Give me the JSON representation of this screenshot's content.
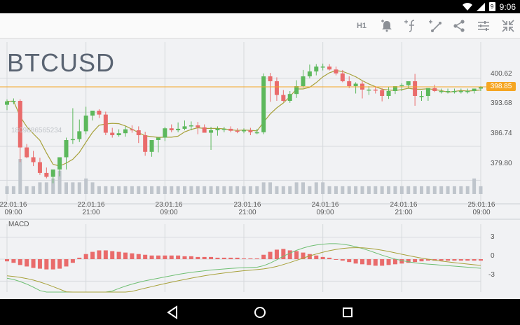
{
  "status": {
    "time": "9:06",
    "battery_level": "9"
  },
  "toolbar": {
    "interval": "H1"
  },
  "chart": {
    "symbol": "BTCUSD",
    "ghost_text": "1809886565234",
    "current_price": "398.85",
    "price_labels": [
      "400.62",
      "393.68",
      "386.74",
      "379.80"
    ],
    "time_labels": [
      {
        "date": "22.01.16",
        "time": "09:00"
      },
      {
        "date": "22.01.16",
        "time": "21:00"
      },
      {
        "date": "23.01.16",
        "time": "09:00"
      },
      {
        "date": "23.01.16",
        "time": "21:00"
      },
      {
        "date": "24.01.16",
        "time": "09:00"
      },
      {
        "date": "24.01.16",
        "time": "21:00"
      },
      {
        "date": "25.01.16",
        "time": "09:00"
      }
    ],
    "macd_title": "MACD",
    "macd_labels": [
      "3",
      "0",
      "-3"
    ],
    "colors": {
      "up": "#5cb85c",
      "down": "#e96b6b",
      "price_line": "#f5a623",
      "volume": "#bfc5cc"
    }
  },
  "chart_data": {
    "type": "candlestick",
    "x": [
      "22.01.16 09:00",
      "22.01.16 10:00",
      "22.01.16 11:00",
      "22.01.16 12:00",
      "22.01.16 13:00",
      "22.01.16 14:00",
      "22.01.16 15:00",
      "22.01.16 16:00",
      "22.01.16 17:00",
      "22.01.16 18:00",
      "22.01.16 19:00",
      "22.01.16 20:00",
      "22.01.16 21:00",
      "22.01.16 22:00",
      "22.01.16 23:00",
      "23.01.16 00:00",
      "23.01.16 01:00",
      "23.01.16 02:00",
      "23.01.16 03:00",
      "23.01.16 04:00",
      "23.01.16 05:00",
      "23.01.16 06:00",
      "23.01.16 07:00",
      "23.01.16 08:00",
      "23.01.16 09:00",
      "23.01.16 10:00",
      "23.01.16 11:00",
      "23.01.16 12:00",
      "23.01.16 13:00",
      "23.01.16 14:00",
      "23.01.16 15:00",
      "23.01.16 16:00",
      "23.01.16 17:00",
      "23.01.16 18:00",
      "23.01.16 19:00",
      "23.01.16 20:00",
      "23.01.16 21:00",
      "23.01.16 22:00",
      "23.01.16 23:00",
      "24.01.16 00:00",
      "24.01.16 01:00",
      "24.01.16 02:00",
      "24.01.16 03:00",
      "24.01.16 04:00",
      "24.01.16 05:00",
      "24.01.16 06:00",
      "24.01.16 07:00",
      "24.01.16 08:00",
      "24.01.16 09:00",
      "24.01.16 10:00",
      "24.01.16 11:00",
      "24.01.16 12:00",
      "24.01.16 13:00",
      "24.01.16 14:00",
      "24.01.16 15:00",
      "24.01.16 16:00",
      "24.01.16 17:00",
      "24.01.16 18:00",
      "24.01.16 19:00",
      "24.01.16 20:00",
      "24.01.16 21:00",
      "24.01.16 22:00",
      "24.01.16 23:00",
      "25.01.16 00:00",
      "25.01.16 01:00",
      "25.01.16 02:00",
      "25.01.16 03:00",
      "25.01.16 04:00",
      "25.01.16 05:00",
      "25.01.16 06:00",
      "25.01.16 07:00",
      "25.01.16 08:00",
      "25.01.16 09:00"
    ],
    "open": [
      395.2,
      395.9,
      396.0,
      386.5,
      384.5,
      383.5,
      381.3,
      380.5,
      382.0,
      384.5,
      388.0,
      388.2,
      389.8,
      393.0,
      394.0,
      393.2,
      389.5,
      389.0,
      389.4,
      390.2,
      390.0,
      389.0,
      385.6,
      388.0,
      388.5,
      390.4,
      390.0,
      390.3,
      390.8,
      391.0,
      390.6,
      389.5,
      390.0,
      390.3,
      390.3,
      389.9,
      389.8,
      390.0,
      389.6,
      389.6,
      401.0,
      400.0,
      397.2,
      396.0,
      397.4,
      399.0,
      401.0,
      402.0,
      403.0,
      403.0,
      402.4,
      401.6,
      400.0,
      399.0,
      399.5,
      398.3,
      398.3,
      398.2,
      397.0,
      398.0,
      399.0,
      399.2,
      400.0,
      397.0,
      397.0,
      398.6,
      398.0,
      398.0,
      398.0,
      398.0,
      398.0,
      398.0,
      398.5
    ],
    "high": [
      396.3,
      396.5,
      396.3,
      387.2,
      385.8,
      384.4,
      382.4,
      381.6,
      382.6,
      388.5,
      394.5,
      392.2,
      394.8,
      394.0,
      394.3,
      393.8,
      390.5,
      390.2,
      390.8,
      391.0,
      390.8,
      389.7,
      388.0,
      388.6,
      390.7,
      391.2,
      391.6,
      392.0,
      391.8,
      391.7,
      391.2,
      390.7,
      390.8,
      390.7,
      390.8,
      390.4,
      390.4,
      390.5,
      390.3,
      401.6,
      401.7,
      400.8,
      398.2,
      398.0,
      400.2,
      402.3,
      403.4,
      403.5,
      403.6,
      403.5,
      403.0,
      402.3,
      401.0,
      399.8,
      400.0,
      399.0,
      399.0,
      398.6,
      398.8,
      398.9,
      399.6,
      399.8,
      401.5,
      398.0,
      398.0,
      399.3,
      398.5,
      398.5,
      398.5,
      398.5,
      398.5,
      398.5,
      399.0
    ],
    "low": [
      394.1,
      395.3,
      383.5,
      384.3,
      382.7,
      380.9,
      380.2,
      379.2,
      380.6,
      382.0,
      387.2,
      387.6,
      389.2,
      392.0,
      392.5,
      389.0,
      388.5,
      388.7,
      388.7,
      389.5,
      387.4,
      384.8,
      384.6,
      385.5,
      387.8,
      389.6,
      389.6,
      390.0,
      390.0,
      389.2,
      389.8,
      386.0,
      388.9,
      389.6,
      389.6,
      389.4,
      389.4,
      389.0,
      389.2,
      389.2,
      395.8,
      396.0,
      395.8,
      395.6,
      396.6,
      398.7,
      400.6,
      401.2,
      402.2,
      402.2,
      401.2,
      399.8,
      398.6,
      397.5,
      396.5,
      397.2,
      397.5,
      395.9,
      396.4,
      397.4,
      398.0,
      398.5,
      395.0,
      396.0,
      396.0,
      397.8,
      397.5,
      397.5,
      397.5,
      397.5,
      397.5,
      397.5,
      398.0
    ],
    "close": [
      395.9,
      396.0,
      386.5,
      384.5,
      383.5,
      381.3,
      380.5,
      382.0,
      384.5,
      388.0,
      388.2,
      389.8,
      393.0,
      394.0,
      393.2,
      389.5,
      389.0,
      389.4,
      390.2,
      390.0,
      389.0,
      385.6,
      388.0,
      388.5,
      390.4,
      390.0,
      390.3,
      390.8,
      391.0,
      390.6,
      389.5,
      390.0,
      390.3,
      390.3,
      389.9,
      389.8,
      390.0,
      389.6,
      389.6,
      401.0,
      400.0,
      397.2,
      396.0,
      397.4,
      399.0,
      401.0,
      402.0,
      403.0,
      403.0,
      402.4,
      401.6,
      400.0,
      399.0,
      399.5,
      398.3,
      398.3,
      398.2,
      397.0,
      398.0,
      399.0,
      399.2,
      400.0,
      397.0,
      397.0,
      398.6,
      398.0,
      398.0,
      398.0,
      398.0,
      398.0,
      398.0,
      398.5,
      398.85
    ],
    "volume": [
      2,
      2,
      9,
      2,
      2,
      3,
      3,
      4,
      6,
      3,
      3,
      3,
      4,
      3,
      2,
      2,
      2,
      2,
      2,
      2,
      2,
      2,
      2,
      2,
      2,
      2,
      2,
      2,
      2,
      2,
      2,
      2,
      2,
      2,
      2,
      2,
      2,
      2,
      2,
      3,
      3,
      2,
      2,
      2,
      3,
      3,
      2,
      3,
      3,
      2,
      2,
      2,
      2,
      2,
      2,
      2,
      2,
      2,
      2,
      2,
      2,
      2,
      2,
      2,
      2,
      2,
      2,
      2,
      2,
      2,
      2,
      4,
      2
    ],
    "macd_hist": [
      -0.3,
      -0.5,
      -0.8,
      -1.0,
      -1.2,
      -1.3,
      -1.4,
      -1.4,
      -1.3,
      -1.0,
      -0.5,
      0.2,
      0.7,
      1.0,
      1.2,
      1.2,
      1.1,
      1.0,
      0.9,
      0.8,
      0.7,
      0.6,
      0.5,
      0.5,
      0.5,
      0.5,
      0.5,
      0.4,
      0.4,
      0.3,
      0.3,
      0.3,
      0.2,
      0.2,
      0.2,
      0.2,
      0.1,
      0.1,
      0.1,
      0.6,
      1.0,
      1.3,
      1.4,
      1.2,
      1.1,
      0.9,
      0.7,
      0.5,
      0.3,
      0.2,
      0.0,
      -0.2,
      -0.4,
      -0.6,
      -0.7,
      -0.8,
      -0.9,
      -0.9,
      -0.8,
      -0.7,
      -0.6,
      -0.5,
      -0.4,
      -0.3,
      -0.2,
      -0.2,
      -0.2,
      -0.2,
      -0.2,
      -0.2,
      -0.2,
      -0.2,
      -0.2
    ],
    "y_range": [
      377.0,
      408.0
    ],
    "macd_range": [
      -4.5,
      4.5
    ]
  }
}
